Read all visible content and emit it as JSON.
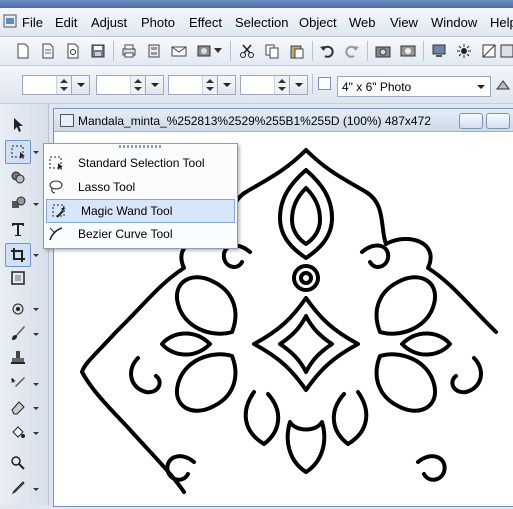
{
  "menu": {
    "items": [
      "File",
      "Edit",
      "Adjust",
      "Photo",
      "Effect",
      "Selection",
      "Object",
      "Web",
      "View",
      "Window",
      "Help"
    ]
  },
  "toolbar2": {
    "preset": "4\" x 6\" Photo"
  },
  "document": {
    "title": "Mandala_minta_%252813%2529%255B1%255D (100%) 487x472"
  },
  "tool_popup": {
    "items": [
      "Standard Selection Tool",
      "Lasso Tool",
      "Magic Wand Tool",
      "Bezier Curve Tool"
    ],
    "highlighted": "Magic Wand Tool"
  },
  "colors": {
    "accent": "#7fa7d9",
    "highlight": "#d7e6f8",
    "line_art": "#000000"
  }
}
